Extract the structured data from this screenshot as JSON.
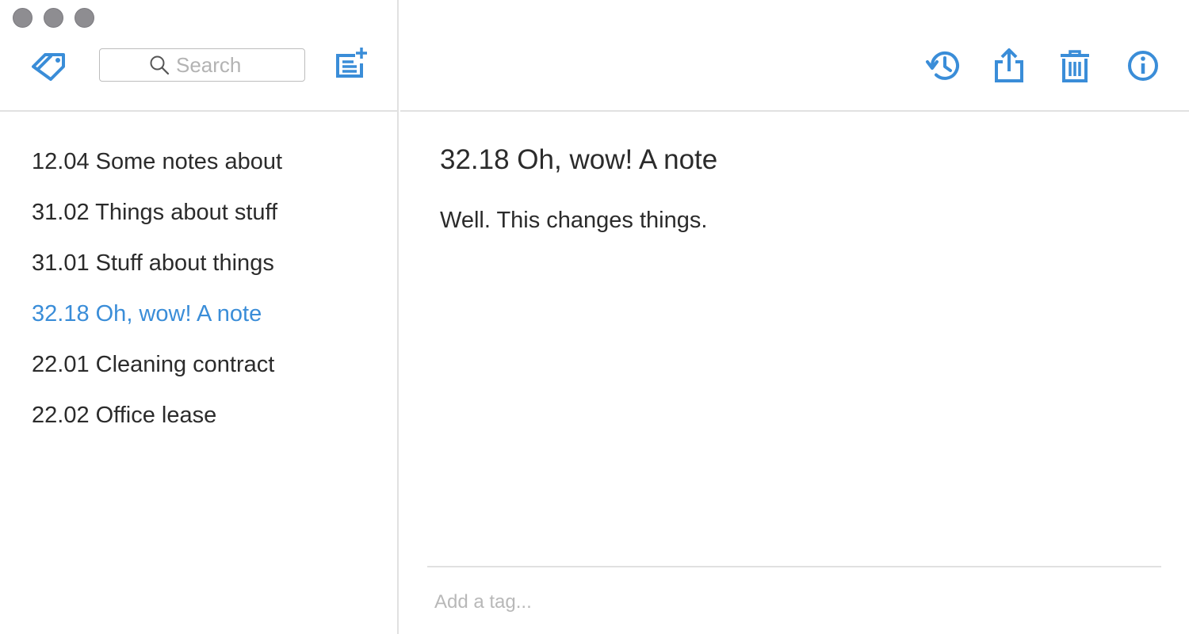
{
  "window": {
    "controls": [
      "close",
      "minimize",
      "zoom"
    ]
  },
  "colors": {
    "accent": "#3a8dd8",
    "text": "#2b2b2b",
    "divider": "#e1e1e1",
    "traffic_light": "#8e8d91"
  },
  "sidebar": {
    "tags_icon": "tag-icon",
    "search": {
      "placeholder": "Search",
      "value": "",
      "icon": "search-icon"
    },
    "new_note_icon": "new-note-icon",
    "notes": [
      {
        "label": "12.04 Some notes about",
        "selected": false
      },
      {
        "label": "31.02 Things about stuff",
        "selected": false
      },
      {
        "label": "31.01 Stuff about things",
        "selected": false
      },
      {
        "label": "32.18 Oh, wow! A note",
        "selected": true
      },
      {
        "label": "22.01 Cleaning contract",
        "selected": false
      },
      {
        "label": "22.02 Office lease",
        "selected": false
      }
    ]
  },
  "toolbar": {
    "icons": [
      "history-icon",
      "share-icon",
      "trash-icon",
      "info-icon"
    ]
  },
  "editor": {
    "title": "32.18 Oh, wow! A note",
    "body": "Well. This changes things.",
    "tag_placeholder": "Add a tag..."
  }
}
